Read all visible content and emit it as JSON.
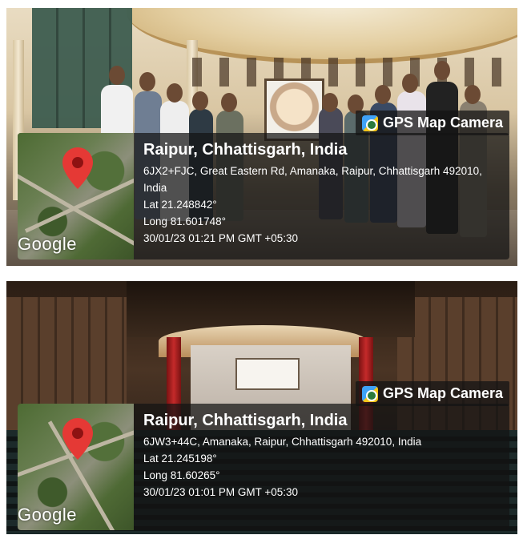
{
  "overlay_brand": "GPS Map Camera",
  "map_logo_text": "Google",
  "icons": {
    "camera_app": "gps-map-camera-icon",
    "location_pin": "map-pin-icon"
  },
  "colors": {
    "pin_red": "#e53935",
    "overlay_bg": "#141414"
  },
  "photos": [
    {
      "location_title": "Raipur, Chhattisgarh, India",
      "address": "6JX2+FJC, Great Eastern Rd, Amanaka, Raipur, Chhattisgarh 492010, India",
      "latitude": "Lat 21.248842°",
      "longitude": "Long 81.601748°",
      "timestamp": "30/01/23 01:21 PM GMT +05:30"
    },
    {
      "location_title": "Raipur, Chhattisgarh, India",
      "address": "6JW3+44C, Amanaka, Raipur, Chhattisgarh 492010, India",
      "latitude": "Lat 21.245198°",
      "longitude": "Long 81.60265°",
      "timestamp": "30/01/23 01:01 PM GMT +05:30"
    }
  ]
}
